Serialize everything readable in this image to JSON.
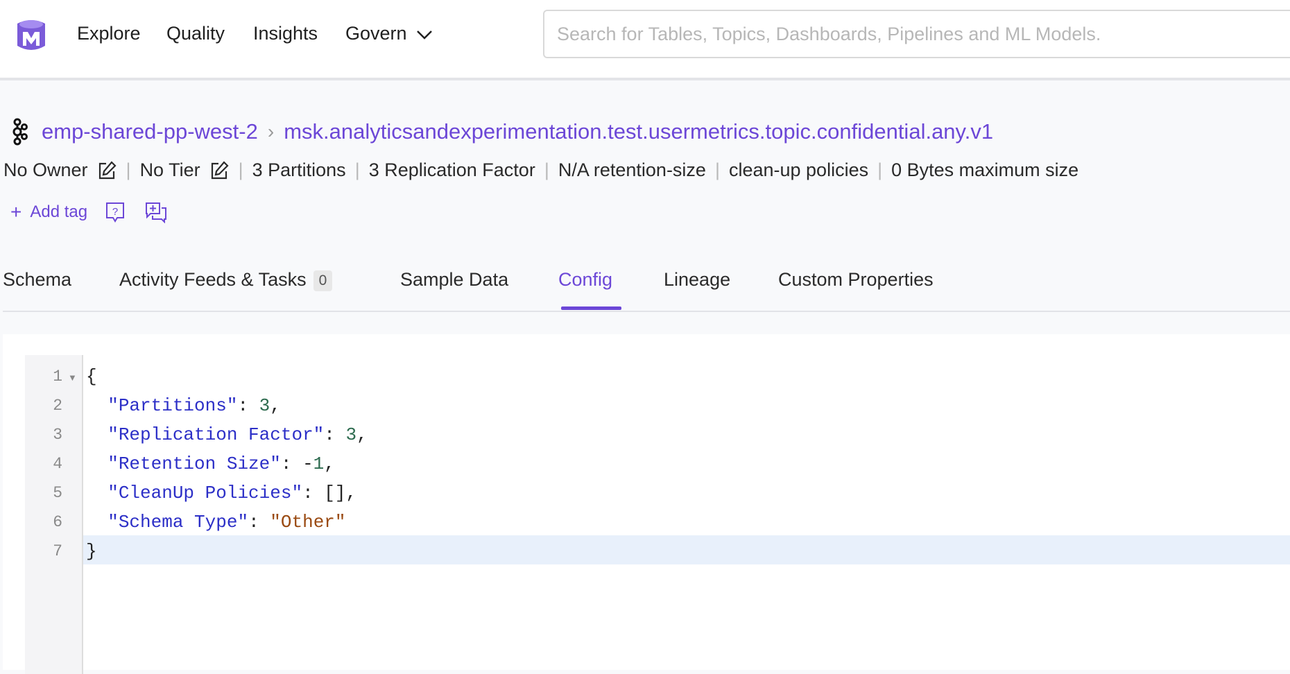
{
  "nav": {
    "items": [
      "Explore",
      "Quality",
      "Insights",
      "Govern"
    ]
  },
  "search": {
    "placeholder": "Search for Tables, Topics, Dashboards, Pipelines and ML Models."
  },
  "breadcrumb": {
    "service": "emp-shared-pp-west-2",
    "topic": "msk.analyticsandexperimentation.test.usermetrics.topic.confidential.any.v1"
  },
  "meta": {
    "owner": "No Owner",
    "tier": "No Tier",
    "partitions": "3 Partitions",
    "replication": "3 Replication Factor",
    "retention": "N/A retention-size",
    "cleanup": "clean-up policies",
    "max_size": "0 Bytes maximum size"
  },
  "tags": {
    "add_label": "Add tag"
  },
  "tabs": [
    {
      "label": "Schema"
    },
    {
      "label": "Activity Feeds & Tasks",
      "count": "0"
    },
    {
      "label": "Sample Data"
    },
    {
      "label": "Config",
      "active": true
    },
    {
      "label": "Lineage"
    },
    {
      "label": "Custom Properties"
    }
  ],
  "editor": {
    "line_numbers": [
      "1",
      "2",
      "3",
      "4",
      "5",
      "6",
      "7"
    ],
    "lines": [
      {
        "open": "{"
      },
      {
        "key": "\"Partitions\"",
        "sep": ": ",
        "value": "3",
        "tail": ","
      },
      {
        "key": "\"Replication Factor\"",
        "sep": ": ",
        "value": "3",
        "tail": ","
      },
      {
        "key": "\"Retention Size\"",
        "sep": ": -",
        "value": "1",
        "tail": ","
      },
      {
        "key": "\"CleanUp Policies\"",
        "sep": ": ",
        "value": "[]",
        "tail": ","
      },
      {
        "key": "\"Schema Type\"",
        "sep": ": ",
        "value": "\"Other\"",
        "tail": ""
      },
      {
        "close": "}"
      }
    ]
  },
  "colors": {
    "accent": "#6c47d7",
    "json_key": "#2c2fc7",
    "json_number": "#2d6b4f",
    "json_string": "#9a4a12",
    "active_line": "#e8f0fb"
  }
}
